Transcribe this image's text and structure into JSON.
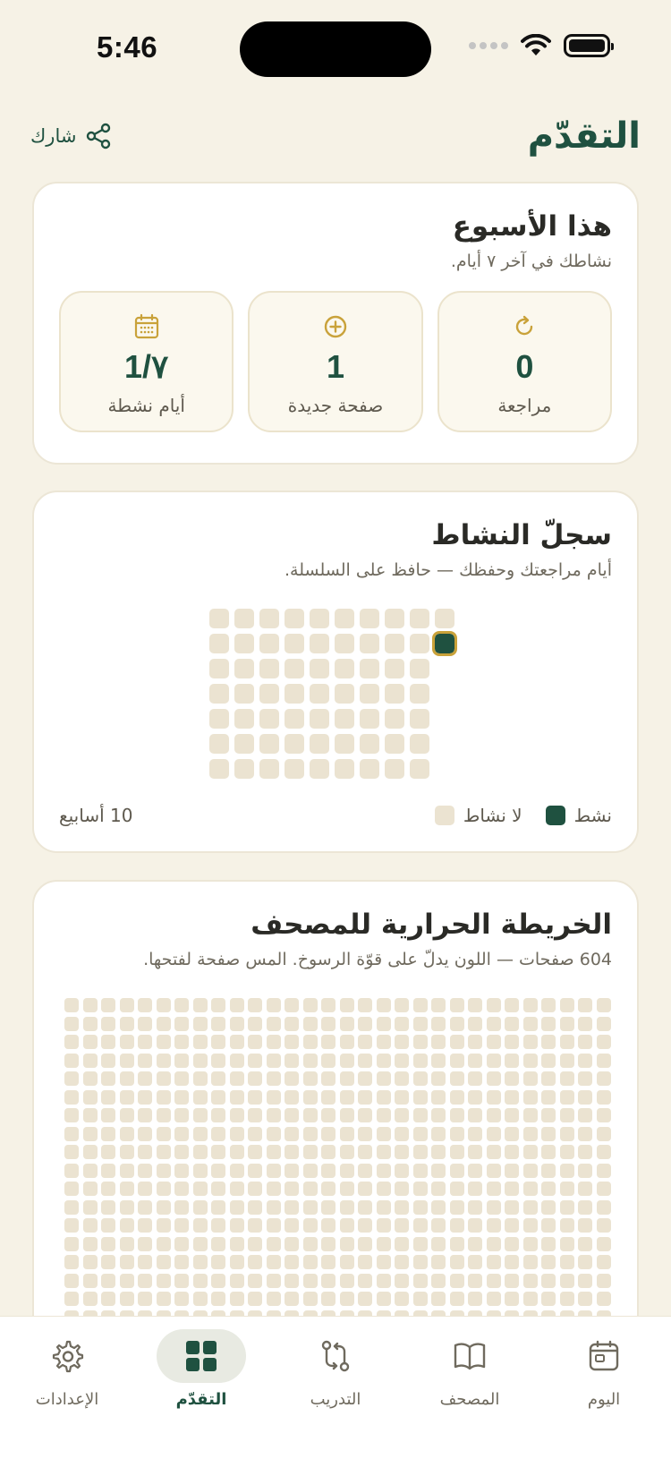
{
  "status_bar": {
    "time": "5:46"
  },
  "header": {
    "title": "التقدّم",
    "share_label": "شارك"
  },
  "week_card": {
    "title": "هذا الأسبوع",
    "subtitle": "نشاطك في آخر ٧ أيام.",
    "stats": [
      {
        "value": "0",
        "label": "مراجعة",
        "icon": "refresh-icon"
      },
      {
        "value": "1",
        "label": "صفحة جديدة",
        "icon": "plus-circle-icon"
      },
      {
        "value": "1/٧",
        "label": "أيام نشطة",
        "icon": "calendar-icon"
      }
    ]
  },
  "activity_card": {
    "title": "سجلّ النشاط",
    "subtitle": "أيام مراجعتك وحفظك — حافظ على السلسلة.",
    "legend_active": "نشط",
    "legend_inactive": "لا نشاط",
    "weeks_label": "10 أسابيع",
    "weeks": 10,
    "days_per_week": 7,
    "active_days": [
      {
        "week": 10,
        "day": 2
      }
    ]
  },
  "heatmap_card": {
    "title": "الخريطة الحرارية للمصحف",
    "subtitle": "604 صفحات — اللون يدلّ على قوّة الرسوخ. المس صفحة لفتحها.",
    "page_count": 604
  },
  "tab_bar": {
    "tabs": [
      {
        "label": "اليوم",
        "icon": "calendar-icon",
        "selected": false
      },
      {
        "label": "المصحف",
        "icon": "book-icon",
        "selected": false
      },
      {
        "label": "التدريب",
        "icon": "swap-icon",
        "selected": false
      },
      {
        "label": "التقدّم",
        "icon": "grid-icon",
        "selected": true
      },
      {
        "label": "الإعدادات",
        "icon": "gear-icon",
        "selected": false
      }
    ]
  },
  "colors": {
    "accent": "#1f5140",
    "gold": "#c9a23a",
    "inactive_cell": "#ebe3d1",
    "background": "#f6f2e6"
  }
}
